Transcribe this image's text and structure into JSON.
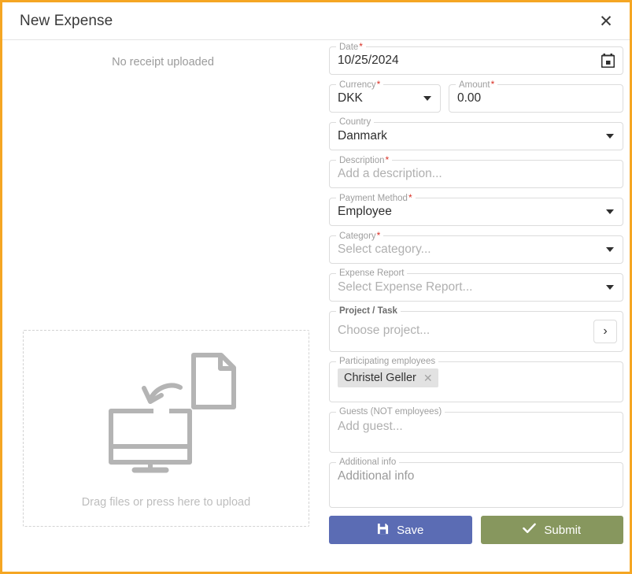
{
  "window": {
    "title": "New Expense",
    "close_label": "✕",
    "border_color": "#f5a623"
  },
  "receipt_panel": {
    "status_text": "No receipt uploaded",
    "dropzone_text": "Drag files or press here to upload",
    "dropzone_icon": "monitor-upload-icon"
  },
  "form": {
    "date": {
      "label": "Date",
      "required": true,
      "value": "10/25/2024",
      "icon": "calendar-icon"
    },
    "currency": {
      "label": "Currency",
      "required": true,
      "value": "DKK",
      "icon": "chevron-down-icon"
    },
    "amount": {
      "label": "Amount",
      "required": true,
      "value": "0.00"
    },
    "country": {
      "label": "Country",
      "required": false,
      "value": "Danmark",
      "icon": "chevron-down-icon"
    },
    "description": {
      "label": "Description",
      "required": true,
      "value": "",
      "placeholder": "Add a description..."
    },
    "payment_method": {
      "label": "Payment Method",
      "required": true,
      "value": "Employee",
      "icon": "chevron-down-icon"
    },
    "category": {
      "label": "Category",
      "required": true,
      "value": "",
      "placeholder": "Select category...",
      "icon": "chevron-down-icon"
    },
    "expense_report": {
      "label": "Expense Report",
      "required": false,
      "value": "",
      "placeholder": "Select Expense Report...",
      "icon": "chevron-down-icon"
    },
    "project_task": {
      "label": "Project / Task",
      "required": false,
      "value": "",
      "placeholder": "Choose project...",
      "button_icon": "chevron-right-icon"
    },
    "participating_employees": {
      "label": "Participating employees",
      "required": false,
      "chips": [
        {
          "name": "Christel Geller",
          "remove_label": "✕"
        }
      ]
    },
    "guests": {
      "label": "Guests (NOT employees)",
      "required": false,
      "value": "",
      "placeholder": "Add guest..."
    },
    "additional_info": {
      "label": "Additional info",
      "required": false,
      "value": "",
      "placeholder": "Additional info"
    }
  },
  "actions": {
    "save": {
      "label": "Save",
      "icon": "save-floppy-icon",
      "color": "#5b6cb4"
    },
    "submit": {
      "label": "Submit",
      "icon": "check-icon",
      "color": "#87975e"
    }
  }
}
